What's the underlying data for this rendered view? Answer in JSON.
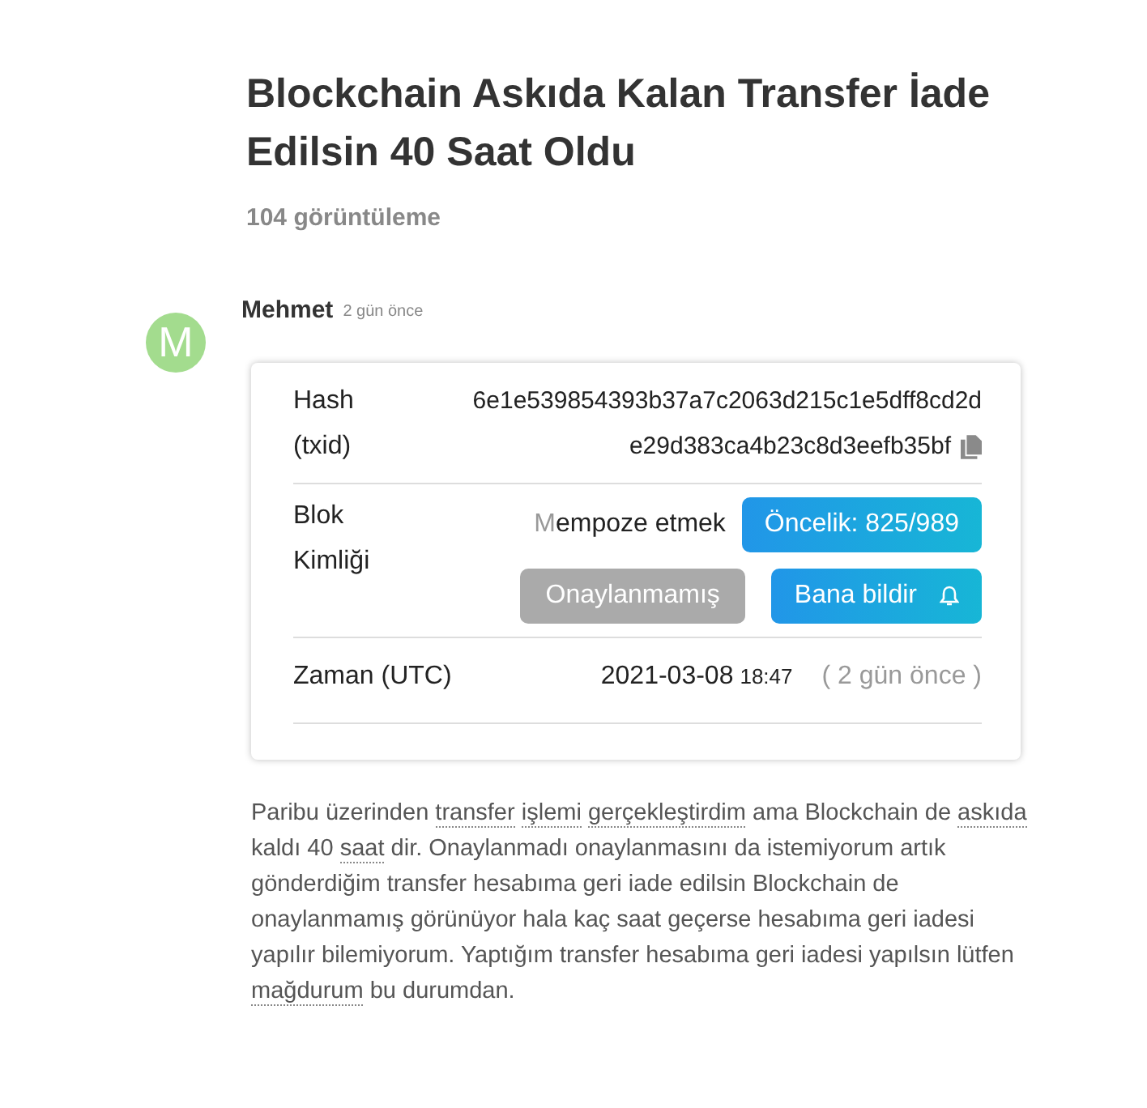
{
  "title": "Blockchain Askıda Kalan Transfer İade Edilsin 40 Saat Oldu",
  "views": "104 görüntüleme",
  "post": {
    "avatar": "M",
    "author": "Mehmet",
    "time": "2 gün önce",
    "card": {
      "hash_label": "Hash (txid)",
      "hash_lines": [
        "6e1e539854393b37a7c2063d215c1e5dff8cd2d",
        "e29d383ca4b23c8d3eefb35bf"
      ],
      "block_label": "Blok Kimliği",
      "mempool_mark": "M",
      "mempool_text": "empoze etmek",
      "buttons": [
        {
          "label": "Öncelik: 825/989",
          "kind": "priority"
        },
        {
          "label": "Onaylanmamış",
          "kind": "status"
        },
        {
          "label": "Bana bildir",
          "kind": "notify"
        }
      ],
      "time_label": "Zaman (UTC)",
      "date": "2021-03-08",
      "clock": "18:47",
      "ago": "( 2 gün önce )"
    },
    "body": [
      {
        "text": "Paribu üzerinden",
        "dotted": false
      },
      {
        "text": "transfer",
        "dotted": true
      },
      {
        "text": "işlemi",
        "dotted": true
      },
      {
        "text": "gerçekleştirdim",
        "dotted": true
      },
      {
        "text": "ama Blockchain de",
        "dotted": false
      },
      {
        "text": "askıda",
        "dotted": true
      },
      {
        "text": "kaldı 40",
        "dotted": false
      },
      {
        "text": "saat",
        "dotted": true
      },
      {
        "text": "dir. Onaylanmadı onaylanmasını da istemiyorum artık gönderdiğim transfer hesabıma geri iade edilsin Blockchain de onaylanmamış görünüyor hala kaç saat geçerse hesabıma geri iadesi yapılır bilemiyorum. Yaptığım transfer hesabıma geri iadesi yapılsın lütfen",
        "dotted": false
      },
      {
        "text": "mağdurum",
        "dotted": true
      },
      {
        "text": "bu durumdan.",
        "dotted": false
      }
    ]
  }
}
